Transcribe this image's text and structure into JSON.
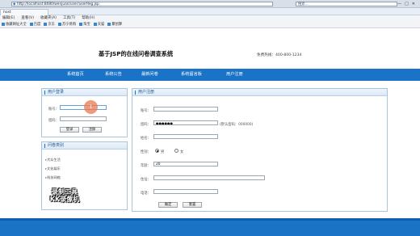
{
  "browser": {
    "address": "http://localhost:8080/wenjuan/user/userReg.jsp",
    "search_placeholder": "搜索...",
    "tab_title": "host",
    "window_buttons": [
      "—",
      "□",
      "✕"
    ],
    "menu": [
      "编辑(E)",
      "查看(V)",
      "收藏夹(A)",
      "工具(T)",
      "帮助(H)"
    ],
    "favorites": [
      "收藏网址大全",
      "百度",
      "京东",
      "苏宁易购",
      "淘宝",
      "天猫",
      "聚划算"
    ]
  },
  "header": {
    "title": "基于JSP的在线问卷调查系统",
    "hotline": "免费热线：400-800-1234"
  },
  "nav": [
    "系统首页",
    "系统公告",
    "最新问卷",
    "系统留言板",
    "用户注册"
  ],
  "login": {
    "heading": "用户登录",
    "account_label": "账号：",
    "password_label": "密码：",
    "login_btn": "登录",
    "register_btn": "注册"
  },
  "categories": {
    "heading": "问卷类别",
    "items": [
      "大众生活",
      "文化娱乐",
      "科技网络"
    ]
  },
  "register": {
    "heading": "用户注册",
    "account_label": "账号：",
    "password_label": "密码：",
    "password_value": "●●●●●●",
    "password_hint": "(默认密码：000000)",
    "name_label": "姓名：",
    "gender_label": "性别：",
    "gender_male": "男",
    "gender_female": "女",
    "age_label": "年龄：",
    "age_value": "20",
    "address_label": "住址：",
    "phone_label": "电话：",
    "submit_btn": "确定",
    "reset_btn": "重置"
  },
  "overlay": {
    "cursor_number": "1",
    "watermark_line1": "录制工具",
    "watermark_line2": "KK录像机"
  }
}
